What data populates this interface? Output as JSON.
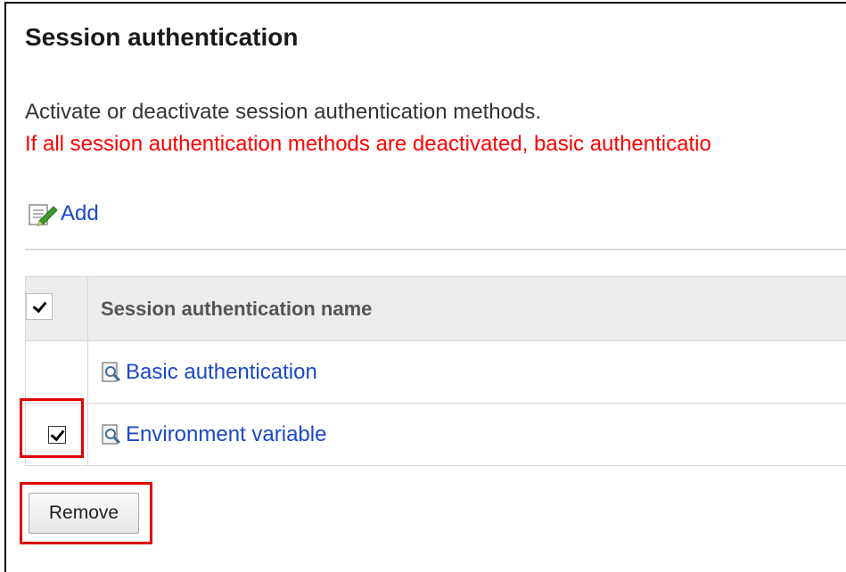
{
  "page": {
    "title": "Session authentication",
    "description": "Activate or deactivate session authentication methods.",
    "warning": "If all session authentication methods are deactivated, basic authenticatio"
  },
  "toolbar": {
    "add_label": "Add",
    "add_icon": "edit-pencil-icon"
  },
  "table": {
    "header": {
      "select_all_checked": true,
      "name_column": "Session authentication name"
    },
    "rows": [
      {
        "label": "Basic authentication",
        "icon": "magnifier-document-icon",
        "checkbox_visible": false,
        "checked": false
      },
      {
        "label": "Environment variable",
        "icon": "magnifier-document-icon",
        "checkbox_visible": true,
        "checked": true
      }
    ]
  },
  "actions": {
    "remove_label": "Remove"
  },
  "colors": {
    "link": "#1a47cc",
    "warning": "#ff0000",
    "highlight": "#e00000",
    "header_bg": "#ececec"
  }
}
